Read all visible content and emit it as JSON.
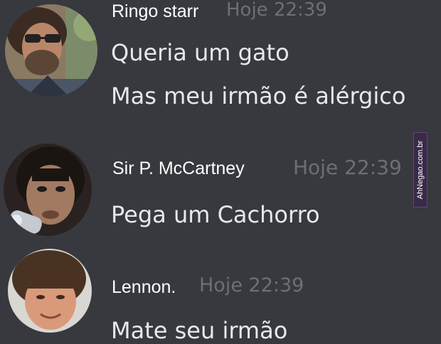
{
  "colors": {
    "background": "#37393e",
    "author": "#ffffff",
    "timestamp": "#6c6f76",
    "message_text": "#e6e8eb"
  },
  "messages": [
    {
      "author": "Ringo starr",
      "timestamp": "Hoje 22:39",
      "avatar": "ringo-avatar",
      "lines": [
        "Queria um gato",
        "Mas meu irmão é alérgico"
      ]
    },
    {
      "author": "Sir P. McCartney",
      "timestamp": "Hoje 22:39",
      "avatar": "paul-avatar",
      "lines": [
        "Pega um Cachorro"
      ]
    },
    {
      "author": "Lennon.",
      "timestamp": "Hoje 22:39",
      "avatar": "lennon-avatar",
      "lines": [
        "Mate seu irmão"
      ]
    }
  ],
  "watermark": "AhNegao.com.br"
}
